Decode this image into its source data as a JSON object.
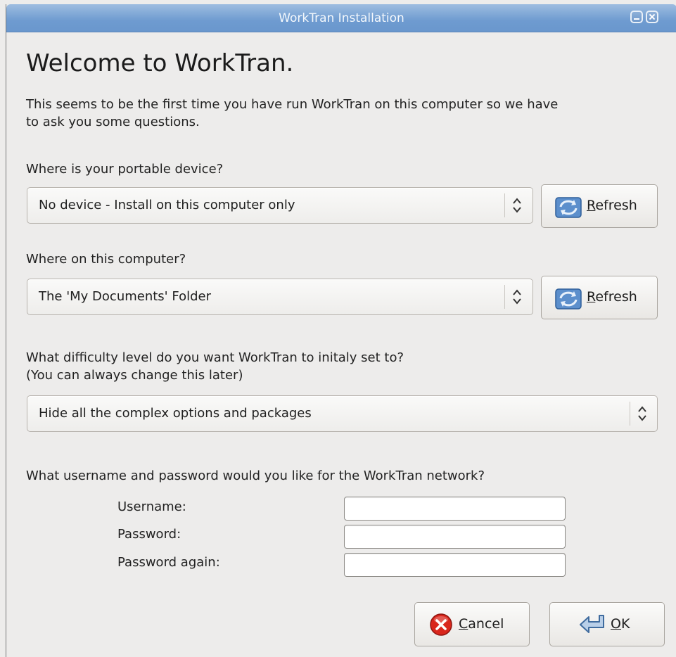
{
  "window": {
    "title": "WorkTran Installation"
  },
  "heading": "Welcome to WorkTran.",
  "intro_line1": "This seems to be the first time you have run WorkTran on this computer so we have",
  "intro_line2": "to ask you some questions.",
  "device": {
    "question": "Where is your portable device?",
    "selected": "No device - Install on this computer only",
    "refresh_accel": "R",
    "refresh_rest": "efresh"
  },
  "location": {
    "question": "Where on this computer?",
    "selected": "The 'My Documents' Folder",
    "refresh_accel": "R",
    "refresh_rest": "efresh"
  },
  "difficulty": {
    "question_line1": "What difficulty level do you want WorkTran to initaly set to?",
    "question_line2": "(You can always change this later)",
    "selected": "Hide all the complex options and packages"
  },
  "account": {
    "question": "What username and password would you like for the WorkTran network?",
    "username_label": "Username:",
    "username_value": "",
    "password_label": "Password:",
    "password_value": "",
    "password_again_label": "Password again:",
    "password_again_value": ""
  },
  "buttons": {
    "cancel_accel": "C",
    "cancel_rest": "ancel",
    "ok_accel": "O",
    "ok_rest": "K"
  },
  "icons": {
    "refresh": "refresh-icon",
    "cancel": "cancel-icon",
    "ok": "ok-icon",
    "combo_arrows": "up-down-arrows-icon"
  },
  "colors": {
    "titlebar": "#6e9bd0",
    "background": "#edeceb",
    "cancel_icon": "#d9261c",
    "refresh_icon": "#4a86c8"
  }
}
